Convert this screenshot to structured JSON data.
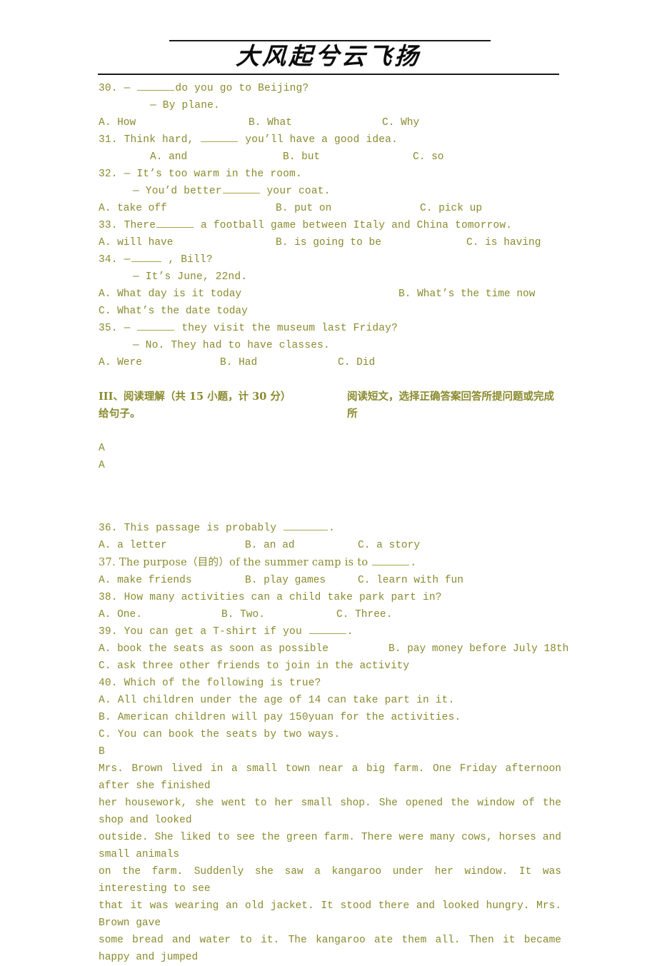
{
  "header": {
    "title": "大风起兮云飞扬"
  },
  "questions": [
    {
      "id": "q30",
      "stem_pre": "30. — ",
      "stem_post": "do you go to Beijing?",
      "blank": "blank-medium",
      "reply": "— By plane.",
      "options": {
        "a": "A. How",
        "b": "B. What",
        "c": "C. Why"
      },
      "layout": "wide"
    },
    {
      "id": "q31",
      "stem_pre": "31. Think hard, ",
      "stem_post": " you’ll have a good idea.",
      "blank": "blank-medium",
      "options": {
        "a": "A. and",
        "b": "B. but",
        "c": "C. so"
      },
      "layout": "indented"
    },
    {
      "id": "q32",
      "stem": "32. — It’s too warm in the room.",
      "reply_pre": "— You’d better",
      "reply_post": " your coat.",
      "blank": "blank-medium",
      "options": {
        "a": "A. take off",
        "b": "B. put on",
        "c": "C. pick up"
      },
      "layout": "mid"
    },
    {
      "id": "q33",
      "stem_pre": "33. There",
      "stem_post": " a football game between Italy and China tomorrow.",
      "blank": "blank-medium",
      "options": {
        "a": "A. will have",
        "b": "B. is going to be",
        "c": "C. is having"
      },
      "layout": "mid"
    },
    {
      "id": "q34",
      "stem_pre": "34. —",
      "stem_post": " , Bill?",
      "blank": "blank-small",
      "reply": "— It’s June, 22nd.",
      "options": {
        "a": "A. What day is it today",
        "b": "B. What’s the time now",
        "c": "C. What’s the date today"
      },
      "layout": "two-line"
    },
    {
      "id": "q35",
      "stem_pre": "35. — ",
      "stem_post": " they visit the museum last Friday?",
      "blank": "blank-medium",
      "reply": "— No. They had to have classes.",
      "options": {
        "a": "A. Were",
        "b": "B. Had",
        "c": "C. Did"
      },
      "layout": "narrow"
    }
  ],
  "section_reading": {
    "heading": "III、阅读理解（共 15 小题，计 30 分）",
    "instruction_line1": "阅读短文，选择正确答案回答所提问题或完成所",
    "instruction_line2": "给句子。",
    "passage_label_a1": "A",
    "passage_label_a2": "A",
    "passage_label_b": "B"
  },
  "reading_questions": [
    {
      "id": "q36",
      "stem_pre": "36. This passage is probably ",
      "stem_post": ".",
      "blank": "blank-large",
      "options": {
        "a": "A. a letter",
        "b": "B. an ad",
        "c": "C. a story"
      },
      "layout": "mid"
    },
    {
      "id": "q37",
      "stem_pre": "37. The purpose（目的）of the summer camp is to ",
      "stem_post": ".",
      "blank": "blank-medium",
      "options": {
        "a": "A. make friends",
        "b": "B. play games",
        "c": "C. learn with fun"
      },
      "layout": "mid"
    },
    {
      "id": "q38",
      "stem": "38. How many activities can a child take park part in?",
      "options": {
        "a": "A. One.",
        "b": "B. Two.",
        "c": "C. Three."
      },
      "layout": "narrow"
    },
    {
      "id": "q39",
      "stem_pre": "39. You can get a T-shirt if you ",
      "stem_post": ".",
      "blank": "blank-medium",
      "options": {
        "a": "A. book the seats as soon as possible",
        "b": "B. pay money before July 18th",
        "c": "C. ask three other friends to join in the activity"
      },
      "layout": "stacked"
    },
    {
      "id": "q40",
      "stem": "40. Which of the following is true?",
      "options": {
        "a": "A. All children under the age of 14 can take part in it.",
        "b": "B. American children will pay 150yuan for the activities.",
        "c": "C. You can book the seats by two ways."
      },
      "layout": "stacked-all"
    }
  ],
  "passage_b": {
    "lines": [
      "Mrs. Brown lived in a small town near a big farm. One Friday afternoon after she finished",
      "her housework, she went to her small shop. She opened the window of the shop and looked",
      "outside. She liked to see the green farm. There were many cows, horses and small animals",
      "on the farm. Suddenly she saw a kangaroo under her window. It was interesting to see",
      "that it was wearing an old jacket. It stood there and looked hungry. Mrs. Brown gave",
      "some bread and water to it. The kangaroo ate them all. Then it became happy and jumped"
    ]
  },
  "colors": {
    "text": "#8a8a2e",
    "rule": "#1a1a1a",
    "title": "#0c0c0c",
    "blank_underline": "#a5a54a"
  }
}
